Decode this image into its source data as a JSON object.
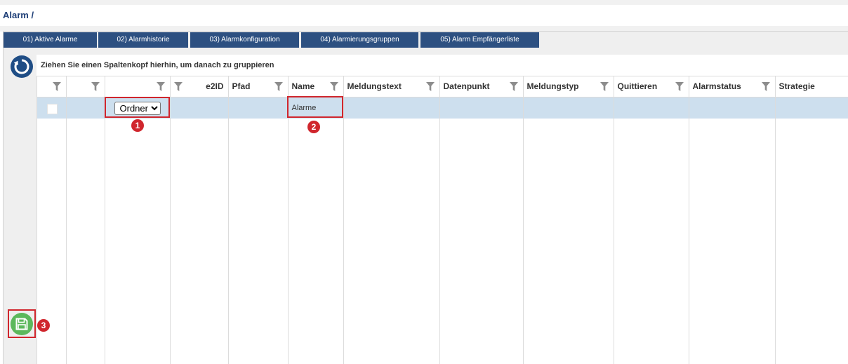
{
  "breadcrumb": {
    "text": "Alarm /"
  },
  "tabs": [
    {
      "label": "01) Aktive Alarme"
    },
    {
      "label": "02) Alarmhistorie"
    },
    {
      "label": "03) Alarmkonfiguration"
    },
    {
      "label": "04) Alarmierungsgruppen"
    },
    {
      "label": "05) Alarm Empfängerliste"
    }
  ],
  "toolbar": {
    "refresh_icon": "refresh-icon",
    "save_icon": "save-icon"
  },
  "grid": {
    "group_panel_text": "Ziehen Sie einen Spaltenkopf hierhin, um danach zu gruppieren",
    "filter_icon": "filter-icon",
    "columns": [
      {
        "label": "",
        "filterable": true
      },
      {
        "label": "",
        "filterable": true
      },
      {
        "label": "",
        "filterable": true
      },
      {
        "label": "e2ID",
        "filterable": true
      },
      {
        "label": "Pfad",
        "filterable": true
      },
      {
        "label": "Name",
        "filterable": true
      },
      {
        "label": "Meldungstext",
        "filterable": true
      },
      {
        "label": "Datenpunkt",
        "filterable": true
      },
      {
        "label": "Meldungstyp",
        "filterable": true
      },
      {
        "label": "Quittieren",
        "filterable": true
      },
      {
        "label": "Alarmstatus",
        "filterable": true
      },
      {
        "label": "Strategie",
        "filterable": false
      }
    ],
    "rows": [
      {
        "selected": true,
        "checked": false,
        "type": "Ordner",
        "name": "Alarme"
      }
    ]
  },
  "callouts": [
    {
      "number": "1"
    },
    {
      "number": "2"
    },
    {
      "number": "3"
    }
  ],
  "colors": {
    "breadcrumb": "#1f3f77",
    "tab_background": "#2d5081",
    "tab_text": "#ffffff",
    "selected_row": "#cddfee",
    "callout": "#d0262d",
    "refresh_icon": "#1f4d85",
    "save_icon": "#5cb85c"
  }
}
